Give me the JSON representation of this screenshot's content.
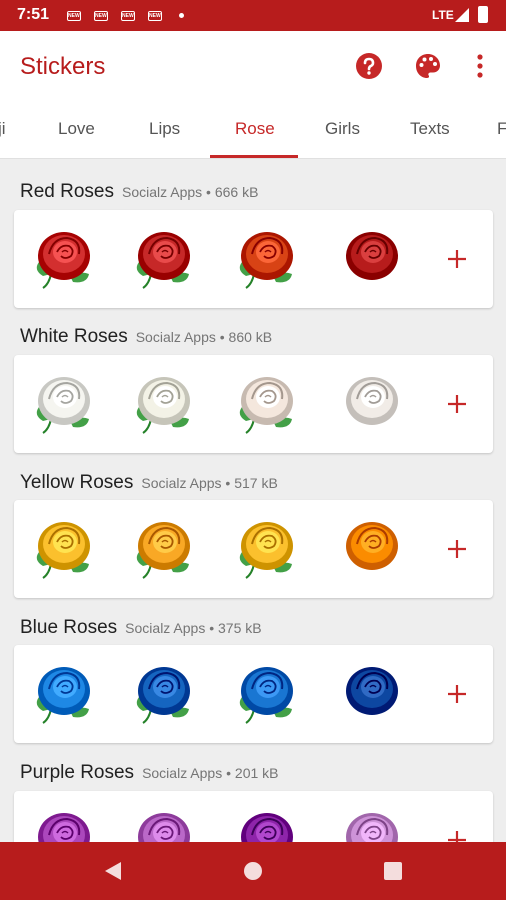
{
  "status": {
    "time": "7:51",
    "network": "LTE",
    "notification_icons": [
      "news-icon",
      "news-icon",
      "news-icon",
      "news-icon"
    ],
    "notif_label": "NEWS"
  },
  "app": {
    "title": "Stickers",
    "icons": [
      "help-icon",
      "palette-icon",
      "more-vert-icon"
    ]
  },
  "tabs": [
    {
      "label": "ji"
    },
    {
      "label": "Love"
    },
    {
      "label": "Lips"
    },
    {
      "label": "Rose",
      "active": true
    },
    {
      "label": "Girls"
    },
    {
      "label": "Texts"
    },
    {
      "label": "F"
    }
  ],
  "packs": [
    {
      "name": "Red Roses",
      "meta": "Socialz Apps • 666 kB",
      "sticker_colors": [
        "#d32f2f",
        "#c62828",
        "#d84315",
        "#b71c1c"
      ]
    },
    {
      "name": "White Roses",
      "meta": "Socialz Apps • 860 kB",
      "sticker_colors": [
        "#f5f5f0",
        "#f3f2e6",
        "#f4e7dd",
        "#f1ece7"
      ]
    },
    {
      "name": "Yellow Roses",
      "meta": "Socialz Apps • 517 kB",
      "sticker_colors": [
        "#fbc02d",
        "#f9a825",
        "#fbc02d",
        "#fb8c00"
      ]
    },
    {
      "name": "Blue Roses",
      "meta": "Socialz Apps • 375 kB",
      "sticker_colors": [
        "#1e88e5",
        "#1565c0",
        "#1976d2",
        "#0d47a1"
      ]
    },
    {
      "name": "Purple Roses",
      "meta": "Socialz Apps • 201 kB",
      "sticker_colors": [
        "#ab47bc",
        "#ba68c8",
        "#8e24aa",
        "#ce93d8"
      ]
    }
  ],
  "colors": {
    "primary": "#b71c1c",
    "accent": "#c62828",
    "leaf": "#43a047"
  },
  "navbar": {
    "icons": [
      "back-icon",
      "home-icon",
      "recents-icon"
    ]
  }
}
